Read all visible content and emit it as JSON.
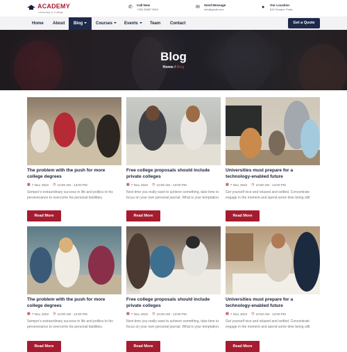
{
  "brand": {
    "title": "ACADEMY",
    "subtitle": "University & College"
  },
  "contacts": [
    {
      "icon": "phone-icon",
      "title": "Call Now",
      "value": "+326 45687 8910"
    },
    {
      "icon": "email-icon",
      "title": "Send Message",
      "value": "info@gmail.com"
    },
    {
      "icon": "location-icon",
      "title": "Our Location",
      "value": "634 Semper Porta"
    }
  ],
  "nav": {
    "items": [
      "Home",
      "About",
      "Blog",
      "Courses",
      "Events",
      "Team",
      "Contact"
    ],
    "active": "Blog",
    "quote_label": "Get a Quote"
  },
  "hero": {
    "title": "Blog",
    "crumb_home": "Home",
    "crumb_sep": "/",
    "crumb_current": "Blog"
  },
  "colors": {
    "accent": "#a51c30",
    "navy": "#1e2a4a"
  },
  "posts": [
    {
      "title": "The problem with the push for more college degrees",
      "date": "7 Nov, 2022",
      "time": "10:00 AM - 13:00 PM",
      "excerpt": "Semper's extraordinary success in life and politics to his perseverance to overcome his personal liabilities.",
      "button": "Read More"
    },
    {
      "title": "Free college proposals should include private colleges",
      "date": "7 Nov, 2022",
      "time": "10:00 AM - 13:00 PM",
      "excerpt": "Next time you really want to achieve something, take time to focus on your own personal journal. What is your temptation.",
      "button": "Read More"
    },
    {
      "title": "Universities must prepare for a technology-enabled future",
      "date": "7 Nov, 2022",
      "time": "10:00 AM - 13:00 PM",
      "excerpt": "Get yourself nice and relaxed and settled. Concentrate engage in the moment and spend some time being still.",
      "button": "Read More"
    },
    {
      "title": "The problem with the push for more college degrees",
      "date": "7 Nov, 2022",
      "time": "10:00 AM - 13:00 PM",
      "excerpt": "Semper's extraordinary success in life and politics to his perseverance to overcome his personal liabilities.",
      "button": "Read More"
    },
    {
      "title": "Free college proposals should include private colleges",
      "date": "7 Nov, 2022",
      "time": "10:00 AM - 13:00 PM",
      "excerpt": "Next time you really want to achieve something, take time to focus on your own personal journal. What is your temptation.",
      "button": "Read More"
    },
    {
      "title": "Universities must prepare for a technology-enabled future",
      "date": "7 Nov, 2022",
      "time": "10:00 AM - 13:00 PM",
      "excerpt": "Get yourself nice and relaxed and settled. Concentrate engage in the moment and spend some time being still.",
      "button": "Read More"
    }
  ]
}
